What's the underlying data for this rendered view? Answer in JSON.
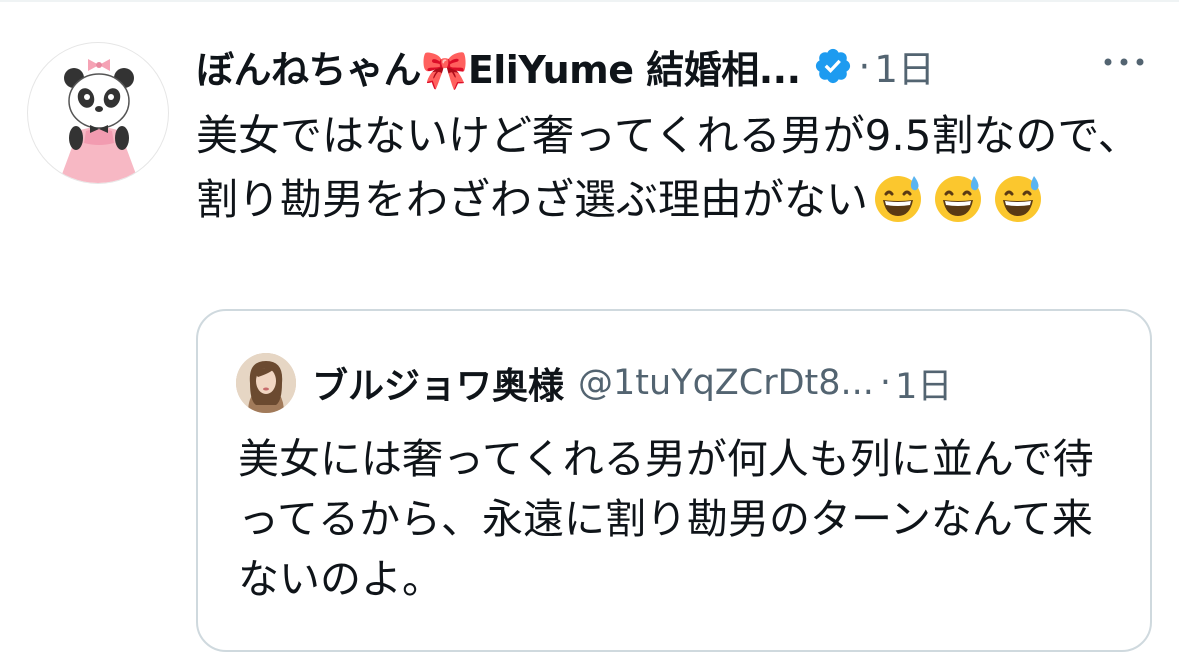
{
  "tweet": {
    "display_name": "ぼんねちゃん🎀EliYume 結婚相...",
    "timestamp": "1日",
    "separator": "·",
    "text": "美女ではないけど奢ってくれる男が9.5割なので、割り勘男をわざわざ選ぶ理由がない",
    "trailing_emojis": [
      "grinning-face-with-sweat",
      "grinning-face-with-sweat",
      "grinning-face-with-sweat"
    ],
    "icons": {
      "avatar": "panda-in-pink-dress-avatar",
      "verified": "verified-badge-icon",
      "more": "more-options-icon"
    },
    "colors": {
      "verified_blue": "#1d9bf0",
      "secondary_text": "#536471",
      "border": "#cfd9de"
    }
  },
  "quote": {
    "display_name": "ブルジョワ奥様",
    "handle": "@1tuYqZCrDt8...",
    "separator": "·",
    "timestamp": "1日",
    "text": "美女には奢ってくれる男が何人も列に並んで待ってるから、永遠に割り勘男のターンなんて来ないのよ。",
    "icons": {
      "avatar": "woman-portrait-avatar"
    }
  }
}
